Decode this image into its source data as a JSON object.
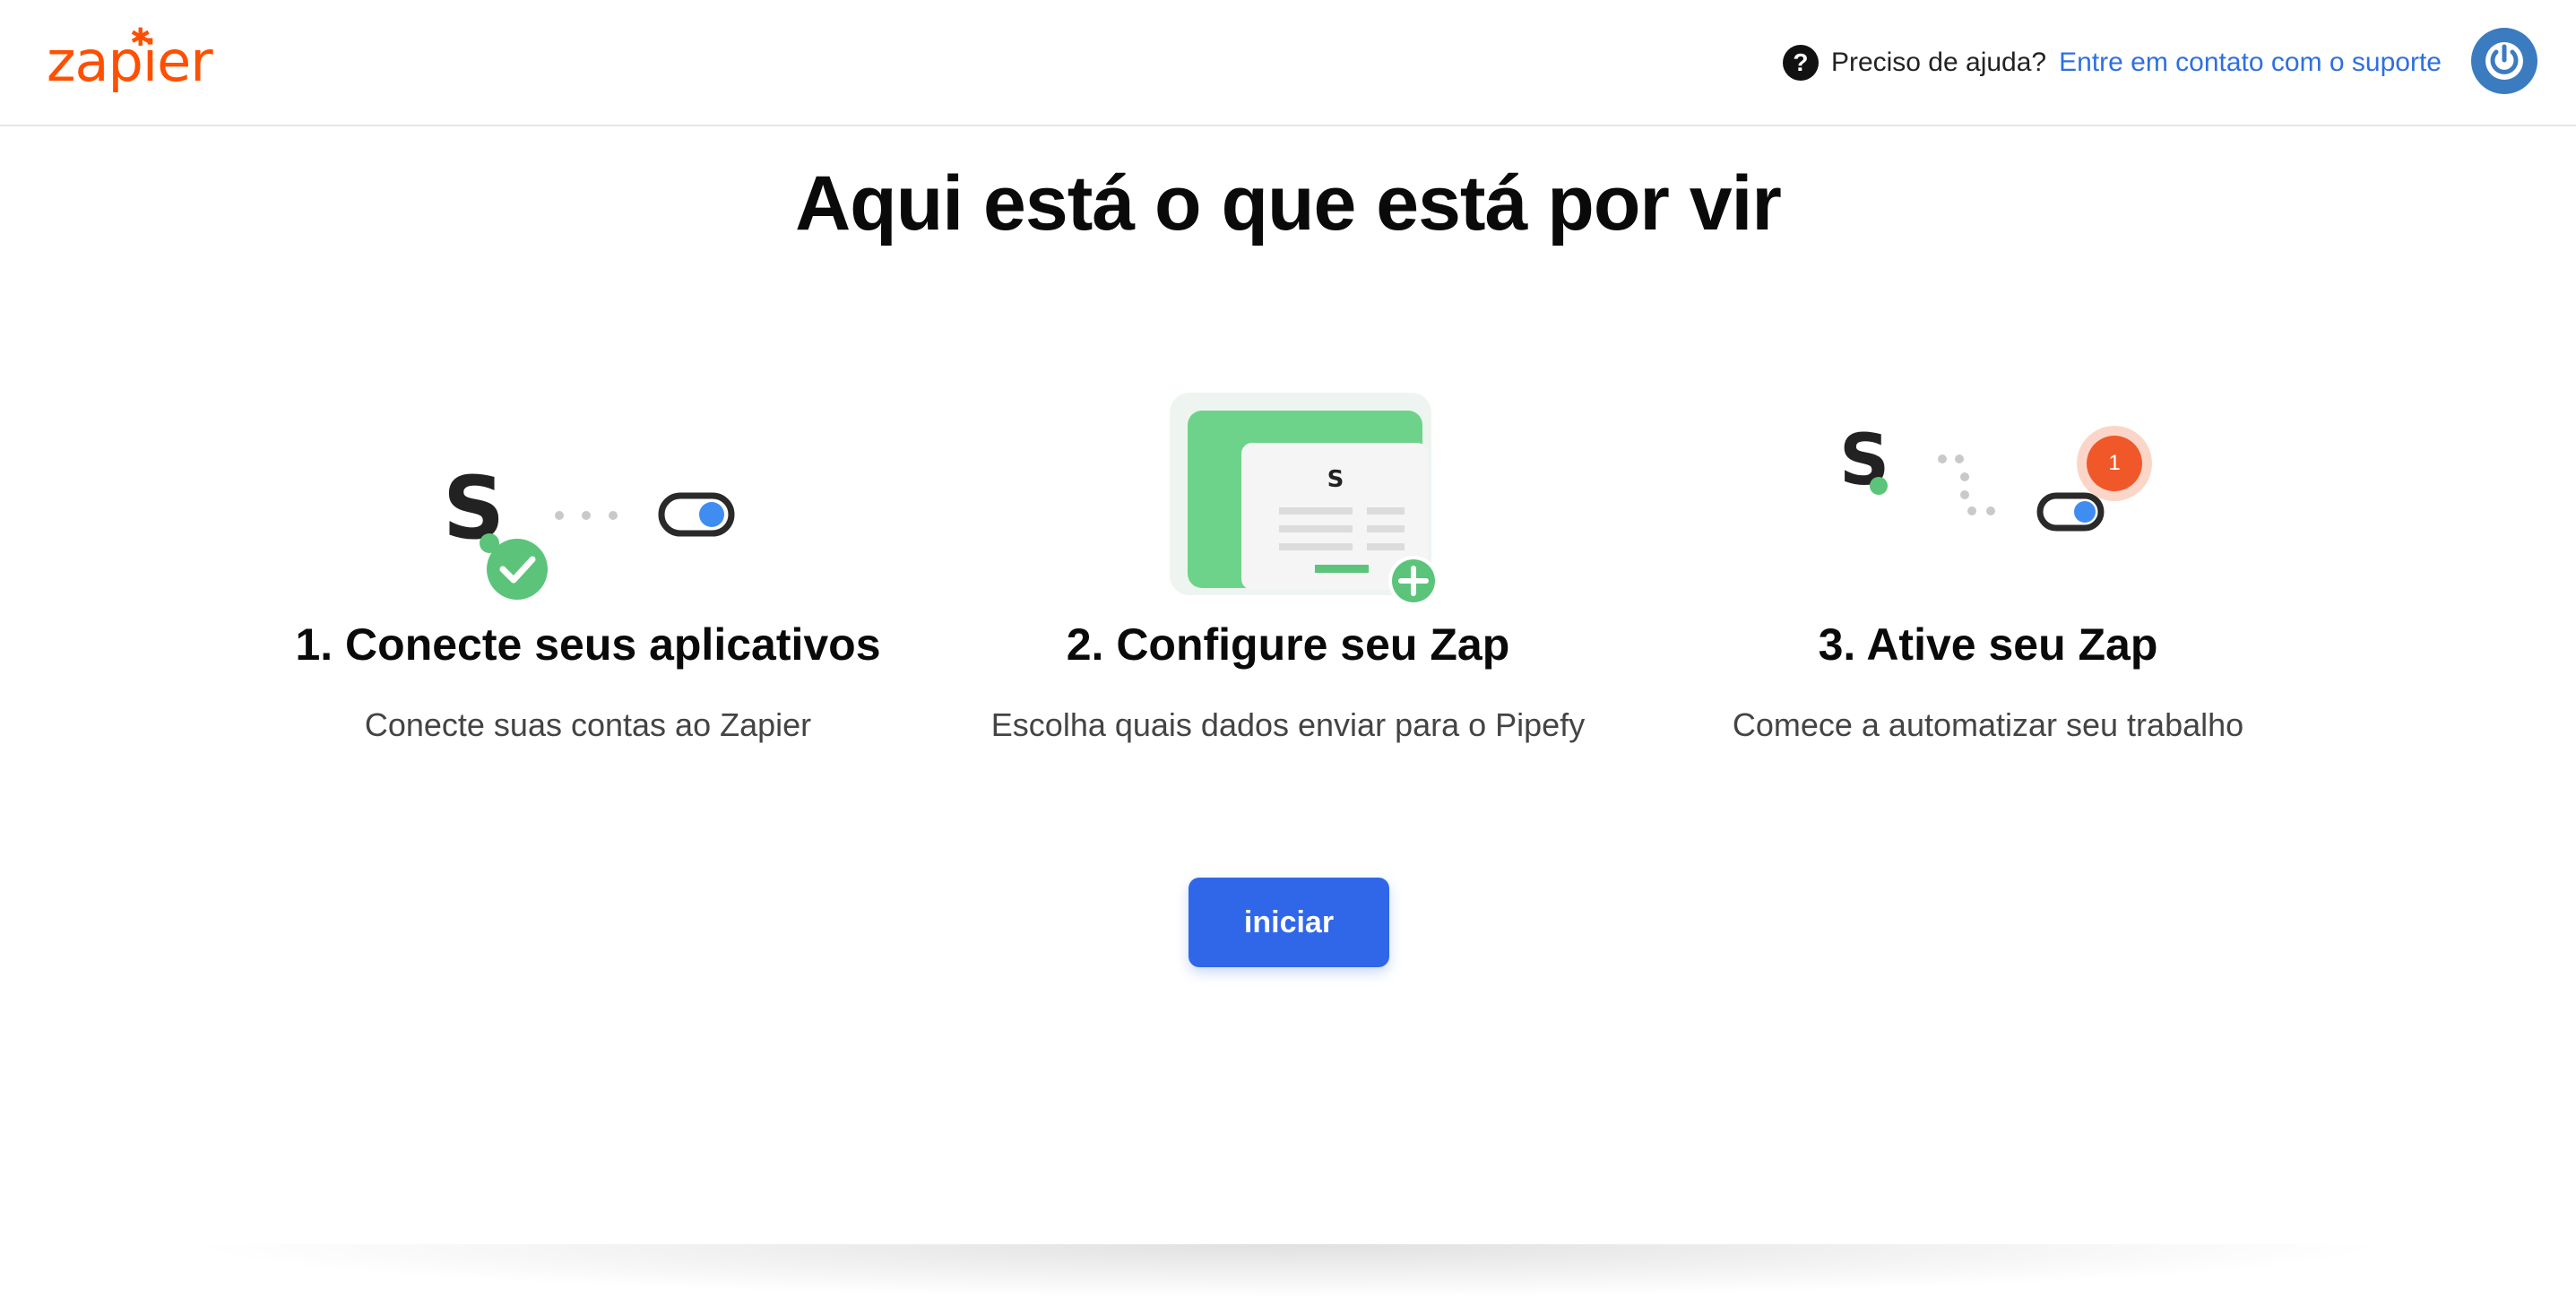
{
  "header": {
    "logo_text": "zapier",
    "help_question": "Preciso de ajuda?",
    "help_link": "Entre em contato com o suporte",
    "help_icon": "question-circle-icon",
    "avatar_icon": "power-icon"
  },
  "main": {
    "title": "Aqui está o que está por vir",
    "steps": [
      {
        "title": "1. Conecte seus aplicativos",
        "description": "Conecte suas contas ao Zapier",
        "icon": "connect-apps-illustration"
      },
      {
        "title": "2. Configure seu Zap",
        "description": "Escolha quais dados enviar para o Pipefy",
        "icon": "configure-zap-illustration"
      },
      {
        "title": "3. Ative seu Zap",
        "description": "Comece a automatizar seu trabalho",
        "icon": "activate-zap-illustration",
        "badge": "1"
      }
    ],
    "start_button": "iniciar"
  },
  "colors": {
    "brand": "#ff4f00",
    "accent": "#2f67e8",
    "link": "#2f6fe0",
    "green": "#5bc47a",
    "badge": "#f0582a"
  }
}
